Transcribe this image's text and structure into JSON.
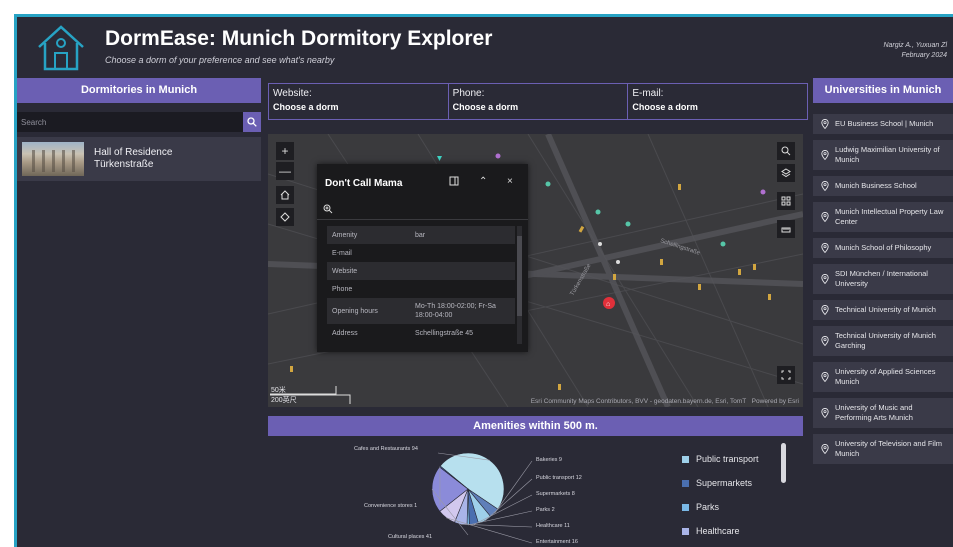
{
  "header": {
    "title": "DormEase: Munich Dormitory Explorer",
    "subtitle": "Choose a dorm of your preference and see what's nearby",
    "authors": "Nargiz A., Yuxuan Zl",
    "date": "February 2024"
  },
  "left": {
    "heading": "Dormitories in Munich",
    "search_placeholder": "Search",
    "dorms": [
      {
        "name_line1": "Hall of Residence",
        "name_line2": "Türkenstraße"
      }
    ]
  },
  "info": [
    {
      "label": "Website:",
      "value": "Choose a dorm"
    },
    {
      "label": "Phone:",
      "value": "Choose a dorm"
    },
    {
      "label": "E-mail:",
      "value": "Choose a dorm"
    }
  ],
  "map": {
    "controls": {
      "zoom_in": "+",
      "zoom_out": "—"
    },
    "popup": {
      "title": "Don't Call Mama",
      "rows": [
        {
          "key": "Amenity",
          "value": "bar"
        },
        {
          "key": "E-mail",
          "value": ""
        },
        {
          "key": "Website",
          "value": ""
        },
        {
          "key": "Phone",
          "value": ""
        },
        {
          "key": "Opening hours",
          "value": "Mo-Th 18:00-02:00; Fr-Sa 18:00-04:00"
        },
        {
          "key": "Address",
          "value": "Schellingstraße 45"
        }
      ]
    },
    "scale_small": "50米",
    "scale_large": "200英尺",
    "attribution": "Esri Community Maps Contributors, BVV - geodaten.bayern.de, Esri, TomT",
    "powered_by": "Powered by Esri",
    "street_1": "Türkenstraße",
    "street_2": "Schellingstraße"
  },
  "amenities": {
    "heading": "Amenities within 500 m.",
    "legend": [
      {
        "label": "Public transport",
        "color": "#9ed0ea"
      },
      {
        "label": "Supermarkets",
        "color": "#4a6fb0"
      },
      {
        "label": "Parks",
        "color": "#7ab8e6"
      },
      {
        "label": "Healthcare",
        "color": "#a9b4e8"
      }
    ]
  },
  "chart_data": {
    "type": "pie",
    "slices": [
      {
        "label": "Cafes and Restaurants 94",
        "value": 94,
        "color": "#b7e0ee"
      },
      {
        "label": "Bakeries 9",
        "value": 9,
        "color": "#5f7fb9"
      },
      {
        "label": "Public transport 12",
        "value": 12,
        "color": "#9ed0ea"
      },
      {
        "label": "Supermarkets 8",
        "value": 8,
        "color": "#4a6fb0"
      },
      {
        "label": "Parks 2",
        "value": 2,
        "color": "#7ab8e6"
      },
      {
        "label": "Healthcare 11",
        "value": 11,
        "color": "#a9b4e8"
      },
      {
        "label": "Entertainment 16",
        "value": 16,
        "color": "#d2c8ee"
      },
      {
        "label": "Cultural places 41",
        "value": 41,
        "color": "#8b8bd9"
      },
      {
        "label": "Convenience stores 1",
        "value": 1,
        "color": "#3b5a9a"
      }
    ]
  },
  "right": {
    "heading": "Universities in Munich",
    "universities": [
      "EU Business School | Munich",
      "Ludwig Maximilian University of Munich",
      "Munich Business School",
      "Munich Intellectual Property Law Center",
      "Munich School of Philosophy",
      "SDI München / International University",
      "Technical University of Munich",
      "Technical University of Munich Garching",
      "University of Applied Sciences Munich",
      "University of Music and Performing Arts Munich",
      "University of Television and Film Munich"
    ]
  }
}
